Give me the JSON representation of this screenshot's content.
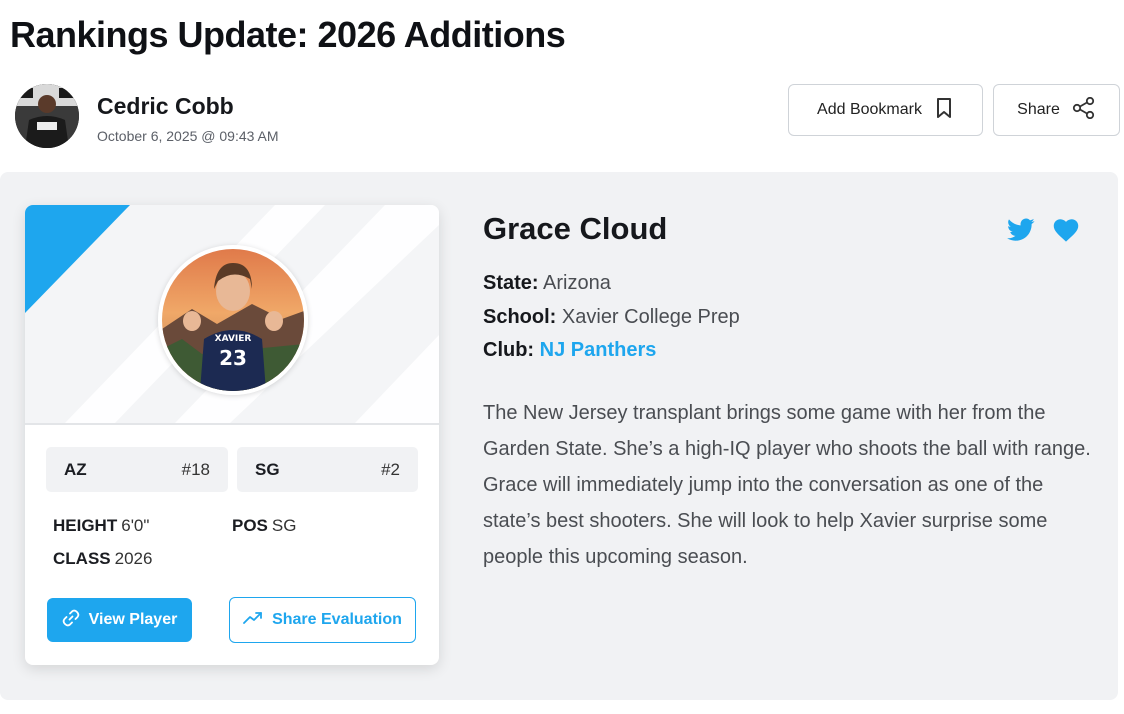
{
  "article": {
    "title": "Rankings Update: 2026 Additions",
    "author": "Cedric Cobb",
    "date": "October 6, 2025 @ 09:43 AM"
  },
  "actions": {
    "bookmark_label": "Add Bookmark",
    "share_label": "Share"
  },
  "player": {
    "name": "Grace Cloud",
    "state_label": "State:",
    "state": "Arizona",
    "school_label": "School:",
    "school": "Xavier College Prep",
    "club_label": "Club:",
    "club": "NJ Panthers",
    "jersey_text": "XAVIER",
    "jersey_number": "23",
    "rankings": [
      {
        "label": "AZ",
        "value": "#18"
      },
      {
        "label": "SG",
        "value": "#2"
      }
    ],
    "stats": {
      "height_label": "HEIGHT",
      "height": "6'0\"",
      "pos_label": "POS",
      "pos": "SG",
      "class_label": "CLASS",
      "class": "2026"
    },
    "view_player_label": "View Player",
    "share_eval_label": "Share Evaluation",
    "description": "The New Jersey transplant brings some game with her from the Garden State. She’s a high-IQ player who shoots the ball with range. Grace will immediately jump into the conversation as one of the state’s best shooters. She will look to help Xavier surprise some people this upcoming season."
  },
  "colors": {
    "accent": "#1ea6ee",
    "panel_bg": "#f1f2f4"
  },
  "icons": [
    "bookmark-icon",
    "share-icon",
    "twitter-icon",
    "heart-icon",
    "link-icon",
    "trending-icon"
  ]
}
